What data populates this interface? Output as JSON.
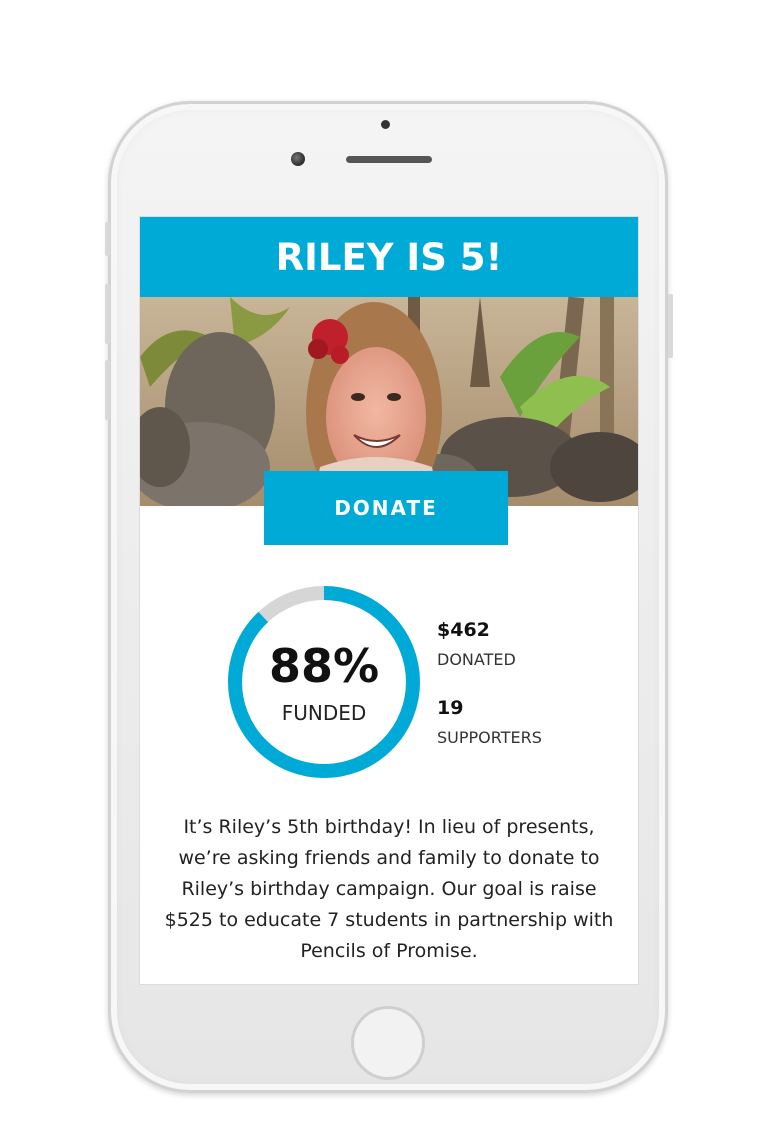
{
  "campaign": {
    "title": "RILEY IS 5!",
    "donate_label": "DONATE",
    "description": "It’s Riley’s 5th birthday! In lieu of presents, we’re asking friends and family to donate to Riley’s birthday campaign. Our goal is raise $525 to educate 7 students in partnership with Pencils of Promise."
  },
  "progress": {
    "percent_text": "88%",
    "funded_label": "FUNDED",
    "fraction": 0.88
  },
  "stats": {
    "donated_value": "$462",
    "donated_label": "DONATED",
    "supporters_value": "19",
    "supporters_label": "SUPPORTERS"
  },
  "colors": {
    "accent": "#00aad6",
    "ring_track": "#d6d6d6"
  },
  "icons": {
    "phone_home": "home-button-icon",
    "camera": "front-camera-icon",
    "speaker": "speaker-icon"
  }
}
